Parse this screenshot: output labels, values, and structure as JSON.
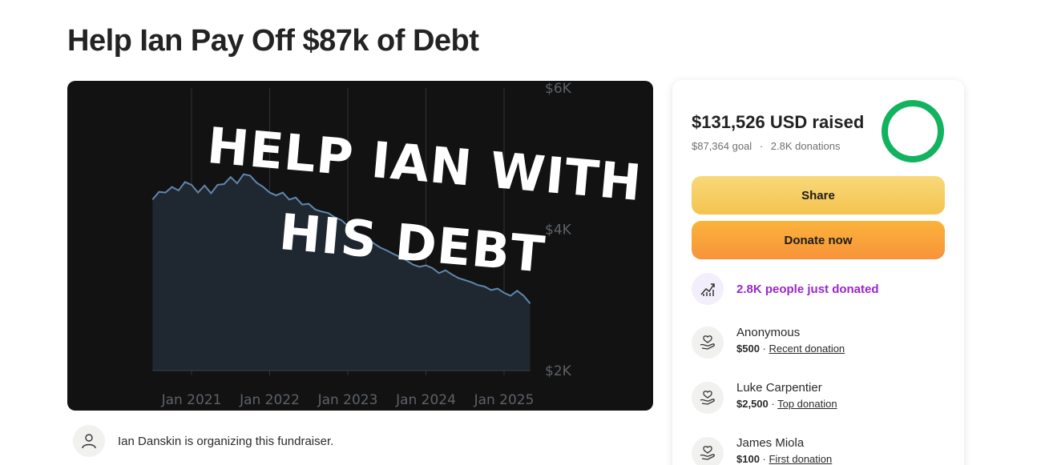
{
  "page": {
    "title": "Help Ian Pay Off $87k of Debt"
  },
  "hero": {
    "overlay_line1": "HELP IAN WITH",
    "overlay_line2": "HIS DEBT",
    "chart_data": {
      "type": "area",
      "title": "",
      "x_ticks": [
        "Jan 2021",
        "Jan 2022",
        "Jan 2023",
        "Jan 2024",
        "Jan 2025"
      ],
      "y_ticks": [
        "$6K",
        "$4K",
        "$2K"
      ],
      "ylim": [
        2000,
        6000
      ],
      "grid": true,
      "series": [
        {
          "name": "",
          "x": [
            "2020-07",
            "2020-08",
            "2020-09",
            "2020-10",
            "2020-11",
            "2020-12",
            "2021-01",
            "2021-02",
            "2021-03",
            "2021-04",
            "2021-05",
            "2021-06",
            "2021-07",
            "2021-08",
            "2021-09",
            "2021-10",
            "2021-11",
            "2021-12",
            "2022-01",
            "2022-02",
            "2022-03",
            "2022-04",
            "2022-05",
            "2022-06",
            "2022-07",
            "2022-08",
            "2022-09",
            "2022-10",
            "2022-11",
            "2022-12",
            "2023-01",
            "2023-02",
            "2023-03",
            "2023-04",
            "2023-05",
            "2023-06",
            "2023-07",
            "2023-08",
            "2023-09",
            "2023-10",
            "2023-11",
            "2023-12",
            "2024-01",
            "2024-02",
            "2024-03",
            "2024-04",
            "2024-05",
            "2024-06",
            "2024-07",
            "2024-08",
            "2024-09",
            "2024-10",
            "2024-11",
            "2024-12",
            "2025-01",
            "2025-02",
            "2025-03",
            "2025-04",
            "2025-05"
          ],
          "y": [
            4420,
            4530,
            4520,
            4600,
            4550,
            4670,
            4630,
            4520,
            4620,
            4510,
            4630,
            4640,
            4740,
            4650,
            4780,
            4760,
            4660,
            4600,
            4520,
            4480,
            4520,
            4420,
            4450,
            4350,
            4360,
            4280,
            4250,
            4230,
            4170,
            4130,
            4050,
            3980,
            3900,
            3880,
            3800,
            3740,
            3700,
            3650,
            3610,
            3560,
            3500,
            3470,
            3490,
            3450,
            3380,
            3420,
            3360,
            3310,
            3280,
            3250,
            3210,
            3190,
            3140,
            3160,
            3100,
            3060,
            3130,
            3060,
            2950
          ]
        }
      ]
    }
  },
  "organizer": {
    "text": "Ian Danskin is organizing this fundraiser."
  },
  "panel": {
    "raised": "$131,526 USD raised",
    "goal": "$87,364 goal",
    "separator": "·",
    "donations": "2.8K donations",
    "progress_fraction": 1.0,
    "progress_color": "#12b35f",
    "share_label": "Share",
    "donate_label": "Donate now",
    "trend_label": "2.8K people just donated",
    "trend_color": "#9b27c9",
    "donors": [
      {
        "name": "Anonymous",
        "amount": "$500",
        "sep": " · ",
        "tag": "Recent donation"
      },
      {
        "name": "Luke Carpentier",
        "amount": "$2,500",
        "sep": " · ",
        "tag": "Top donation"
      },
      {
        "name": "James Miola",
        "amount": "$100",
        "sep": " · ",
        "tag": "First donation"
      }
    ]
  }
}
